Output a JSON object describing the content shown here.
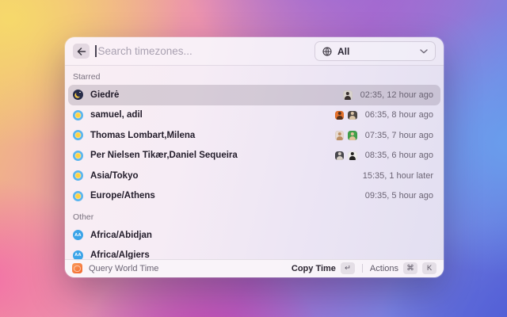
{
  "search": {
    "placeholder": "Search timezones...",
    "filter": {
      "value": "All"
    }
  },
  "sections": [
    {
      "label": "Starred",
      "rows": [
        {
          "name": "Giedrė",
          "icon": "moon",
          "selected": true,
          "avatars": [
            {
              "bg": "#d9d3cd",
              "fg": "#39312e"
            }
          ],
          "time": "02:35, 12 hour ago"
        },
        {
          "name": "samuel, adil",
          "icon": "sun",
          "selected": false,
          "avatars": [
            {
              "bg": "#e5702b",
              "fg": "#54301c"
            },
            {
              "bg": "#4d4644",
              "fg": "#d9c3a6"
            }
          ],
          "time": "06:35, 8 hour ago"
        },
        {
          "name": "Thomas Lombart,Milena",
          "icon": "sun",
          "selected": false,
          "avatars": [
            {
              "bg": "#e7dad1",
              "fg": "#bb8e64"
            },
            {
              "bg": "#41a04a",
              "fg": "#e2c29c"
            }
          ],
          "time": "07:35, 7 hour ago"
        },
        {
          "name": "Per Nielsen Tikær,Daniel Sequeira",
          "icon": "sun",
          "selected": false,
          "avatars": [
            {
              "bg": "#47464c",
              "fg": "#d7cfc7"
            },
            {
              "bg": "#f0eeec",
              "fg": "#232220"
            }
          ],
          "time": "08:35, 6 hour ago"
        },
        {
          "name": "Asia/Tokyo",
          "icon": "sun",
          "selected": false,
          "avatars": [],
          "time": "15:35, 1 hour later"
        },
        {
          "name": "Europe/Athens",
          "icon": "sun",
          "selected": false,
          "avatars": [],
          "time": "09:35, 5 hour ago"
        }
      ]
    },
    {
      "label": "Other",
      "rows": [
        {
          "name": "Africa/Abidjan",
          "icon": "initials",
          "initials": "AA",
          "selected": false,
          "avatars": [],
          "time": ""
        },
        {
          "name": "Africa/Algiers",
          "icon": "initials",
          "initials": "AA",
          "selected": false,
          "avatars": [],
          "time": ""
        }
      ]
    }
  ],
  "status_bar": {
    "app_name": "Query World Time",
    "primary_action": {
      "label": "Copy Time",
      "key": "↵"
    },
    "secondary_action": {
      "label": "Actions",
      "keys": [
        "⌘",
        "K"
      ]
    }
  },
  "colors": {
    "sun_icon_bg": "#58b5ef",
    "sun_icon_core": "#ffd33f",
    "moon_icon_bg": "#272c49",
    "moon_icon_crescent": "#f6c945",
    "initials_icon_bg": "#3ba4e8",
    "selected_row": "rgba(103,90,110,0.22)",
    "app_icon_orange": "#f2692c"
  }
}
